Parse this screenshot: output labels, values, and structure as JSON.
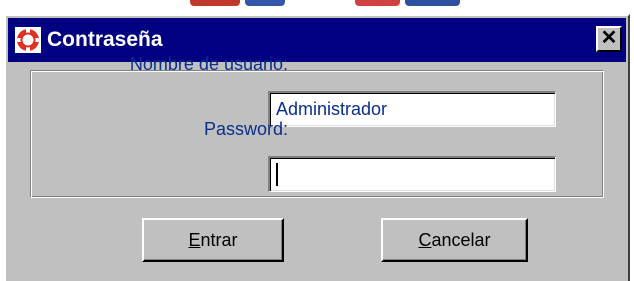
{
  "window": {
    "title": "Contraseña",
    "icon": "lifebuoy-icon",
    "close_glyph": "✕"
  },
  "form": {
    "username_label": "Nombre de usuario:",
    "username_value": "Administrador",
    "password_label": "Password:",
    "password_value": ""
  },
  "buttons": {
    "enter": {
      "mnemonic": "E",
      "rest": "ntrar"
    },
    "cancel": {
      "mnemonic": "C",
      "rest": "ancelar"
    }
  },
  "colors": {
    "titlebar": "#000080",
    "dialog_face": "#c0c0c0",
    "label_text": "#0b2e8c"
  }
}
